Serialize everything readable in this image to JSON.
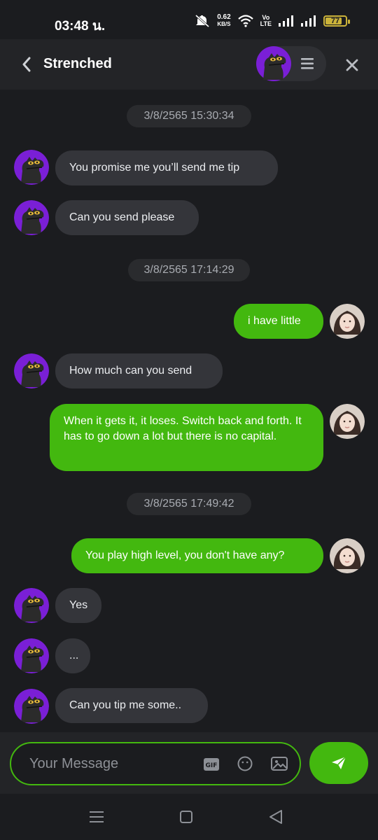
{
  "status_bar": {
    "time": "03:48 น.",
    "net_speed_value": "0.62",
    "net_speed_unit": "KB/S",
    "volte_top": "Vo",
    "volte_bottom": "LTE",
    "battery": "77",
    "battery_level": 0.77
  },
  "header": {
    "title": "Strenched"
  },
  "messages": [
    {
      "type": "date",
      "text": "3/8/2565 15:30:34"
    },
    {
      "type": "in",
      "text": "You promise me you’ll send me tip"
    },
    {
      "type": "in",
      "text": "Can you send please"
    },
    {
      "type": "date",
      "text": "3/8/2565 17:14:29"
    },
    {
      "type": "out",
      "text": "i have little"
    },
    {
      "type": "in",
      "text": "How much can you send"
    },
    {
      "type": "out",
      "text": "When it gets it, it loses. Switch back and forth. It has to go down a lot but there is no capital."
    },
    {
      "type": "date",
      "text": "3/8/2565 17:49:42"
    },
    {
      "type": "out",
      "text": "You play high level, you don't have any?"
    },
    {
      "type": "in",
      "text": "Yes"
    },
    {
      "type": "in",
      "text": "..."
    },
    {
      "type": "in",
      "text": "Can you tip me some.."
    }
  ],
  "composer": {
    "placeholder": "Your Message",
    "gif_label": "GIF"
  },
  "colors": {
    "accent": "#43b80f",
    "background": "#1b1c1f",
    "incoming_bubble": "#34353a",
    "avatar_purple": "#7a1fd6"
  },
  "icons": {
    "back": "chevron-left-icon",
    "menu": "menu-icon",
    "close": "close-icon",
    "gif": "gif-icon",
    "emoji": "emoji-icon",
    "image": "image-icon",
    "send": "send-icon"
  }
}
